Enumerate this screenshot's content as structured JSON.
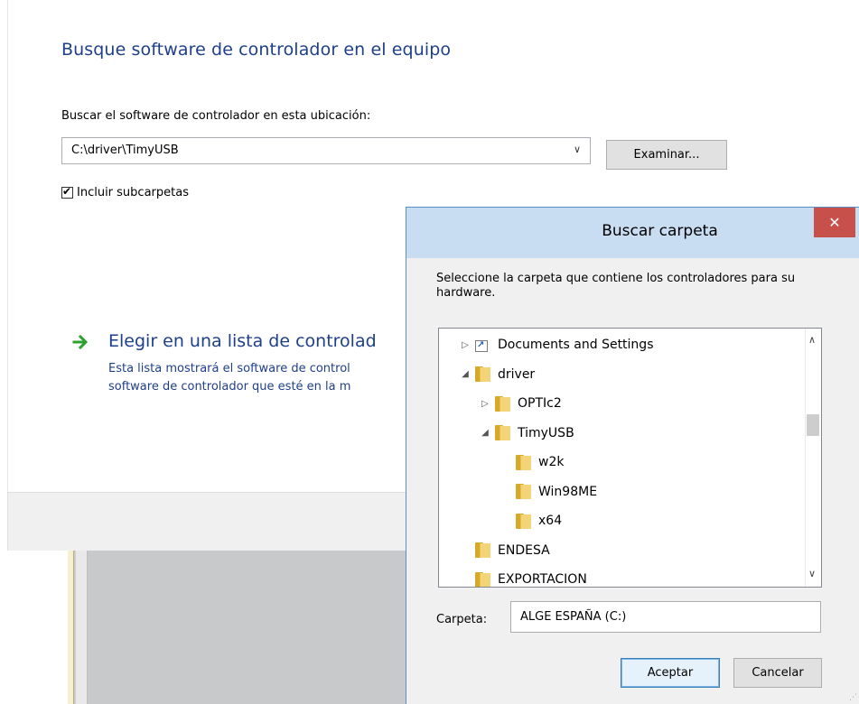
{
  "wizard": {
    "title": "Busque software de controlador en el equipo",
    "location_label": "Buscar el software de controlador en esta ubicación:",
    "path_value": "C:\\driver\\TimyUSB",
    "browse_label": "Examinar...",
    "include_subfolders_label": "Incluir subcarpetas",
    "include_subfolders_checked": true,
    "pick_title": "Elegir en una lista de controlad",
    "pick_desc_line1": "Esta lista mostrará el software de control",
    "pick_desc_line2": "software de controlador que esté en la m"
  },
  "dialog": {
    "title": "Buscar carpeta",
    "close_glyph": "✕",
    "prompt": "Seleccione la carpeta que contiene los controladores para su hardware.",
    "tree": [
      {
        "label": "Documents and Settings",
        "expander": "▷",
        "icon": "shortcut-folder-icon",
        "level": 0
      },
      {
        "label": "driver",
        "expander": "◢",
        "icon": "folder-icon",
        "level": 0
      },
      {
        "label": "OPTIc2",
        "expander": "▷",
        "icon": "folder-icon",
        "level": 1
      },
      {
        "label": "TimyUSB",
        "expander": "◢",
        "icon": "folder-icon",
        "level": 1
      },
      {
        "label": "w2k",
        "expander": "",
        "icon": "folder-icon",
        "level": 2
      },
      {
        "label": "Win98ME",
        "expander": "",
        "icon": "folder-icon",
        "level": 2
      },
      {
        "label": "x64",
        "expander": "",
        "icon": "folder-icon",
        "level": 2
      },
      {
        "label": "ENDESA",
        "expander": "",
        "icon": "folder-icon",
        "level": 0
      },
      {
        "label": "EXPORTACION",
        "expander": "",
        "icon": "folder-icon",
        "level": 0
      }
    ],
    "folder_label": "Carpeta:",
    "folder_value": "ALGE ESPAÑA (C:)",
    "ok_label": "Aceptar",
    "cancel_label": "Cancelar"
  },
  "colors": {
    "accent_text": "#1e3f8a",
    "titlebar": "#c8dcf2",
    "close": "#c7504a",
    "arrow_green": "#2da12d"
  }
}
